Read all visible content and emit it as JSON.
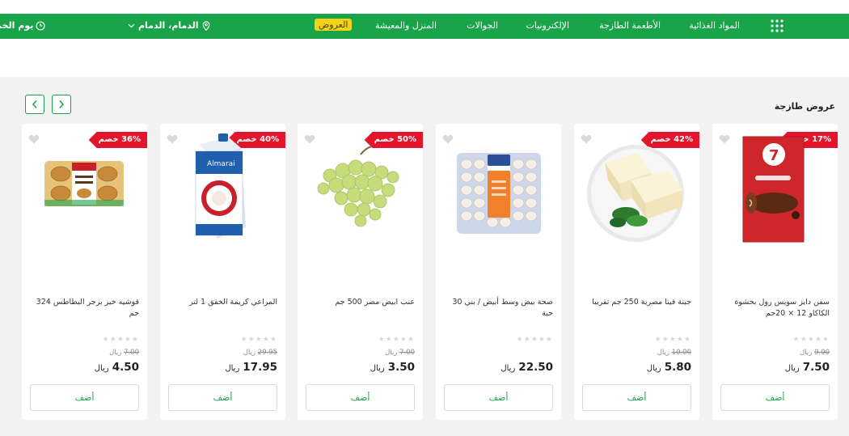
{
  "header": {
    "categories": [
      "المواد الغذائية",
      "الأطعمة الطازجة",
      "الإلكترونيات",
      "الجوالات",
      "المنزل والمعيشة"
    ],
    "offers_label": "العروض",
    "location_label": "الدمام، الدمام",
    "delivery_label": "يوم الخم"
  },
  "section": {
    "title": "عروض طازجة"
  },
  "products": [
    {
      "name": "سفن دايز سويس رول بحشوة الكاكاو 12 × 20جم",
      "badge": "17% خصم",
      "old_price": "9.00",
      "old_currency": "ريال",
      "price": "7.50",
      "currency": "ريال",
      "add_label": "أضف",
      "image": "cake-roll"
    },
    {
      "name": "جبنة فيتا مصرية 250 جم تقريبا",
      "badge": "42% خصم",
      "old_price": "10.00",
      "old_currency": "ريال",
      "price": "5.80",
      "currency": "ريال",
      "add_label": "أضف",
      "image": "feta-cheese"
    },
    {
      "name": "صحة بيض وسط أبيض / بني 30 حبة",
      "badge": "",
      "old_price": "",
      "old_currency": "",
      "price": "22.50",
      "currency": "ريال",
      "add_label": "أضف",
      "image": "egg-tray"
    },
    {
      "name": "عنب ابيض مصر 500 جم",
      "badge": "50% خصم",
      "old_price": "7.00",
      "old_currency": "ريال",
      "price": "3.50",
      "currency": "ريال",
      "add_label": "أضف",
      "image": "green-grapes"
    },
    {
      "name": "المراعي كريمة الخفق 1 لتر",
      "badge": "40% خصم",
      "old_price": "29.95",
      "old_currency": "ريال",
      "price": "17.95",
      "currency": "ريال",
      "add_label": "أضف",
      "image": "whipping-cream"
    },
    {
      "name": "قوشيه خبز برجر البطاطس 324 جم",
      "badge": "36% خصم",
      "old_price": "7.00",
      "old_currency": "ريال",
      "price": "4.50",
      "currency": "ريال",
      "add_label": "أضف",
      "image": "burger-buns"
    }
  ],
  "colors": {
    "brand_green": "#1aa449",
    "badge_red": "#e3142b",
    "offers_yellow": "#f3d21a"
  }
}
